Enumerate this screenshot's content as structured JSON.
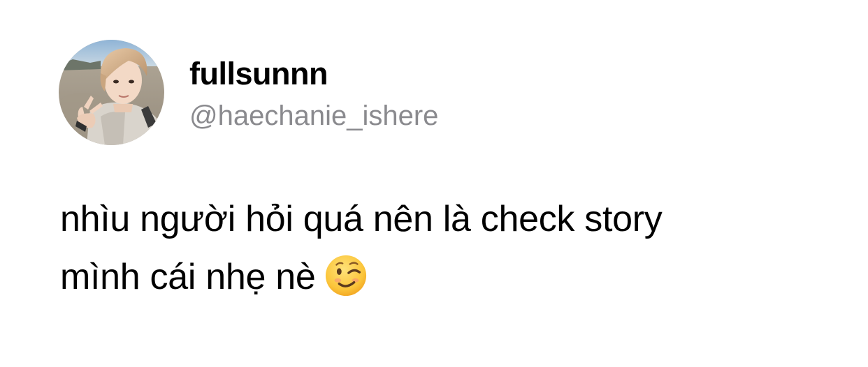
{
  "tweet": {
    "author": {
      "display_name": "fullsunnn",
      "handle": "@haechanie_ishere",
      "avatar_icon": "profile-photo"
    },
    "text_lines": [
      "nhìu người hỏi quá nên là check story",
      "mình cái nhẹ nè"
    ],
    "emoji": "winking-face-emoji"
  },
  "colors": {
    "background": "#ffffff",
    "text": "#000000",
    "handle": "#8a8a8e"
  }
}
